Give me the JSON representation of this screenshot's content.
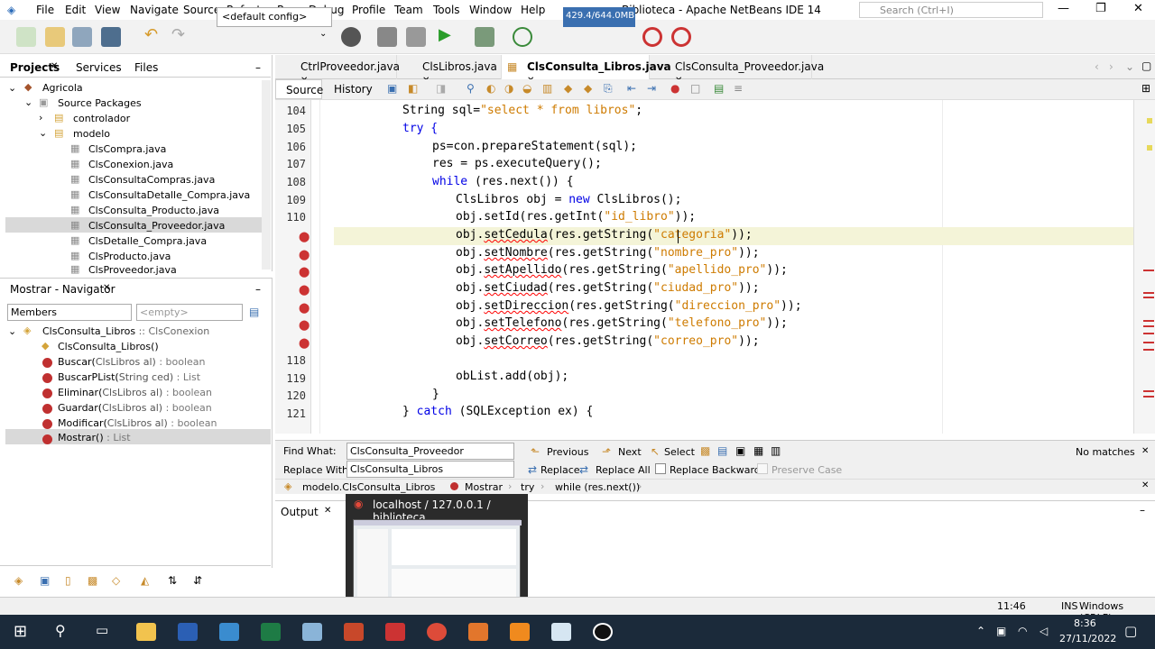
{
  "menubar": {
    "items": [
      "File",
      "Edit",
      "View",
      "Navigate",
      "Source",
      "Refactor",
      "Run",
      "Debug",
      "Profile",
      "Team",
      "Tools",
      "Window",
      "Help"
    ],
    "title": "Biblioteca - Apache NetBeans IDE 14",
    "search_placeholder": "Search (Ctrl+I)"
  },
  "toolbar": {
    "config": "<default config>",
    "memory": "429.4/644.0MB"
  },
  "projects": {
    "tabs": [
      "Projects",
      "Services",
      "Files"
    ],
    "tree": [
      {
        "label": "Agricola"
      },
      {
        "label": "Source Packages"
      },
      {
        "label": "controlador"
      },
      {
        "label": "modelo"
      },
      {
        "label": "ClsCompra.java"
      },
      {
        "label": "ClsConexion.java"
      },
      {
        "label": "ClsConsultaCompras.java"
      },
      {
        "label": "ClsConsultaDetalle_Compra.java"
      },
      {
        "label": "ClsConsulta_Producto.java"
      },
      {
        "label": "ClsConsulta_Proveedor.java"
      },
      {
        "label": "ClsDetalle_Compra.java"
      },
      {
        "label": "ClsProducto.java"
      },
      {
        "label": "ClsProveedor.java"
      }
    ]
  },
  "navigator": {
    "title": "Mostrar - Navigator",
    "members": "Members",
    "filter": "<empty>",
    "root": "ClsConsulta_Libros",
    "root_super": ":: ClsConexion",
    "items": [
      {
        "name": "ClsConsulta_Libros()",
        "sig": ""
      },
      {
        "name": "Buscar(",
        "arg": "ClsLibros al)",
        "sig": " : boolean"
      },
      {
        "name": "BuscarPList(",
        "arg": "String ced)",
        "sig": " : List"
      },
      {
        "name": "Eliminar(",
        "arg": "ClsLibros al)",
        "sig": " : boolean"
      },
      {
        "name": "Guardar(",
        "arg": "ClsLibros al)",
        "sig": " : boolean"
      },
      {
        "name": "Modificar(",
        "arg": "ClsLibros al)",
        "sig": " : boolean"
      },
      {
        "name": "Mostrar()",
        "arg": "",
        "sig": " : List"
      }
    ]
  },
  "editor": {
    "tabs": [
      "CtrlProveedor.java",
      "ClsLibros.java",
      "ClsConsulta_Libros.java",
      "ClsConsulta_Proveedor.java"
    ],
    "source_tab": "Source",
    "history_tab": "History",
    "line_numbers": [
      "104",
      "105",
      "106",
      "107",
      "108",
      "109",
      "110",
      "",
      "",
      "",
      "",
      "",
      "",
      "",
      "",
      "118",
      "119",
      "120",
      "121"
    ],
    "lines": [
      {
        "p": [
          "String sql=",
          "\"select * from libros\"",
          ";"
        ]
      },
      {
        "p": [
          "try {"
        ]
      },
      {
        "p": [
          "ps=con.prepareStatement(sql);"
        ]
      },
      {
        "p": [
          "res = ps.executeQuery();"
        ]
      },
      {
        "p": [
          "while (res.next()) {"
        ]
      },
      {
        "p": [
          "ClsLibros obj = ",
          "new",
          " ClsLibros();"
        ]
      },
      {
        "p": [
          "obj.setId(res.getInt(",
          "\"id_libro\"",
          "));"
        ]
      },
      {
        "p": [
          "obj.",
          "setCedula",
          "(res.getString(",
          "\"categoria\"",
          "));"
        ]
      },
      {
        "p": [
          "obj.",
          "setNombre",
          "(res.getString(",
          "\"nombre_pro\"",
          "));"
        ]
      },
      {
        "p": [
          "obj.",
          "setApellido",
          "(res.getString(",
          "\"apellido_pro\"",
          "));"
        ]
      },
      {
        "p": [
          "obj.",
          "setCiudad",
          "(res.getString(",
          "\"ciudad_pro\"",
          "));"
        ]
      },
      {
        "p": [
          "obj.",
          "setDireccion",
          "(res.getString(",
          "\"direccion_pro\"",
          "));"
        ]
      },
      {
        "p": [
          "obj.",
          "setTelefono",
          "(res.getString(",
          "\"telefono_pro\"",
          "));"
        ]
      },
      {
        "p": [
          "obj.",
          "setCorreo",
          "(res.getString(",
          "\"correo_pro\"",
          "));"
        ]
      },
      {
        "p": [
          ""
        ]
      },
      {
        "p": [
          "obList.add(obj);"
        ]
      },
      {
        "p": [
          "}"
        ]
      },
      {
        "p": [
          "} ",
          "catch",
          " (SQLException ex) {"
        ]
      }
    ]
  },
  "find": {
    "find_label": "Find What:",
    "find_value": "ClsConsulta_Proveedor",
    "replace_label": "Replace With:",
    "replace_value": "ClsConsulta_Libros",
    "previous": "Previous",
    "next": "Next",
    "select": "Select",
    "replace": "Replace",
    "replace_all": "Replace All",
    "replace_backwards": "Replace Backwards",
    "preserve_case": "Preserve Case",
    "status": "No matches"
  },
  "breadcrumb": [
    "modelo.ClsConsulta_Libros",
    "Mostrar",
    "try",
    "while (res.next())"
  ],
  "output": {
    "title": "Output"
  },
  "statusbar": {
    "position": "11:46",
    "mode": "INS",
    "eol": "Windows (CRLF)"
  },
  "popup": {
    "title": "localhost / 127.0.0.1 / biblioteca..."
  },
  "taskbar": {
    "time": "8:36",
    "date": "27/11/2022"
  }
}
